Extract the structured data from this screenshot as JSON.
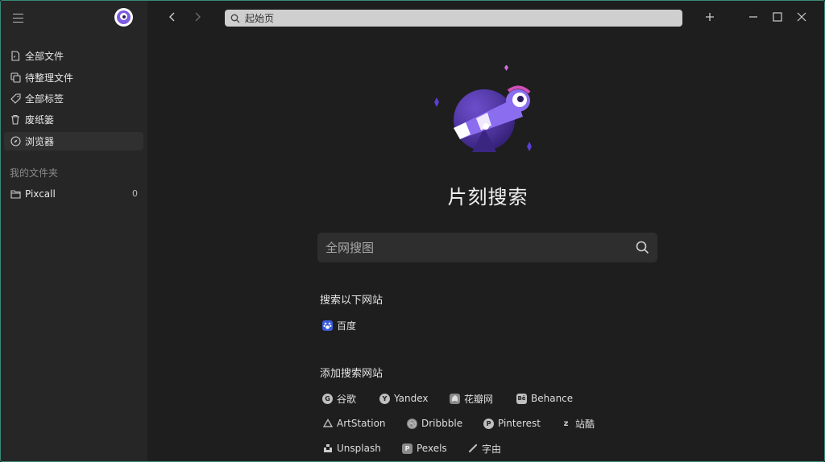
{
  "sidebar": {
    "items": [
      {
        "label": "全部文件",
        "icon": "file-icon"
      },
      {
        "label": "待整理文件",
        "icon": "copy-icon"
      },
      {
        "label": "全部标签",
        "icon": "tag-icon"
      },
      {
        "label": "废纸篓",
        "icon": "trash-icon"
      },
      {
        "label": "浏览器",
        "icon": "compass-icon",
        "active": true
      }
    ],
    "section_title": "我的文件夹",
    "folders": [
      {
        "label": "Pixcall",
        "count": "0",
        "icon": "folder-icon"
      }
    ]
  },
  "toolbar": {
    "url": "起始页"
  },
  "main": {
    "title": "片刻搜索",
    "search_placeholder": "全网搜图",
    "search_sites_title": "搜索以下网站",
    "search_sites": [
      {
        "label": "百度",
        "icon": "baidu-icon",
        "color": "#3a5bd9"
      }
    ],
    "add_sites_title": "添加搜索网站",
    "add_sites": [
      {
        "label": "谷歌",
        "icon": "google-icon"
      },
      {
        "label": "Yandex",
        "icon": "yandex-icon"
      },
      {
        "label": "花瓣网",
        "icon": "huaban-icon"
      },
      {
        "label": "Behance",
        "icon": "behance-icon"
      },
      {
        "label": "ArtStation",
        "icon": "artstation-icon"
      },
      {
        "label": "Dribbble",
        "icon": "dribbble-icon"
      },
      {
        "label": "Pinterest",
        "icon": "pinterest-icon"
      },
      {
        "label": "站酷",
        "icon": "zcool-icon"
      },
      {
        "label": "Unsplash",
        "icon": "unsplash-icon"
      },
      {
        "label": "Pexels",
        "icon": "pexels-icon"
      },
      {
        "label": "字由",
        "icon": "ziyou-icon"
      }
    ]
  },
  "colors": {
    "accent": "#7c5ce0",
    "sidebar_bg": "#262626",
    "main_bg": "#1e1e1e"
  }
}
